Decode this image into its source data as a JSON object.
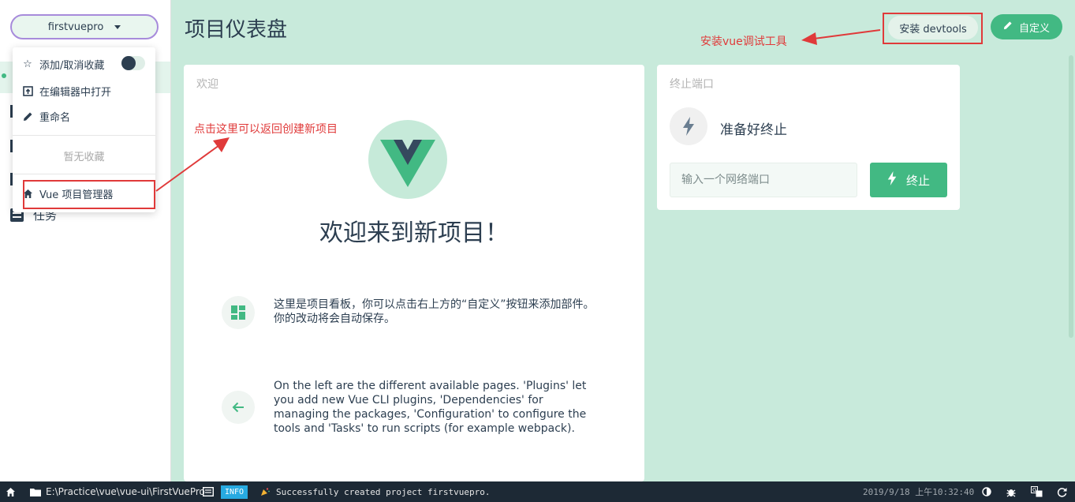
{
  "sidebar": {
    "project_name": "firstvuepro",
    "nav": {
      "task_label": "任务"
    }
  },
  "dropdown": {
    "favorite_label": "添加/取消收藏",
    "open_editor_label": "在编辑器中打开",
    "rename_label": "重命名",
    "empty_favorites": "暂无收藏",
    "project_manager_label": "Vue 项目管理器"
  },
  "header": {
    "title": "项目仪表盘",
    "devtools_label": "安装 devtools",
    "customize_label": "自定义"
  },
  "annotations": {
    "devtools_note": "安装vue调试工具",
    "back_note": "点击这里可以返回创建新项目"
  },
  "welcome": {
    "card_title": "欢迎",
    "heading": "欢迎来到新项目！",
    "tip1": "这里是项目看板，你可以点击右上方的“自定义”按钮来添加部件。你的改动将会自动保存。",
    "tip2": "On the left are the different available pages. 'Plugins' let you add new Vue CLI plugins, 'Dependencies' for managing the packages, 'Configuration' to configure the tools and 'Tasks' to run scripts (for example webpack)."
  },
  "port": {
    "card_title": "终止端口",
    "ready_text": "准备好终止",
    "input_placeholder": "输入一个网络端口",
    "stop_label": "终止"
  },
  "statusbar": {
    "path": "E:\\Practice\\vue\\vue-ui\\FirstVuePro",
    "log_level": "INFO",
    "message": "Successfully created project firstvuepro.",
    "timestamp": "2019/9/18 上午10:32:40"
  },
  "colors": {
    "accent": "#42b983",
    "background": "#c8eadb",
    "dark": "#2c3e50",
    "annotation": "#e03a3a",
    "statusbar": "#1d2935",
    "info_badge": "#27aae1"
  }
}
